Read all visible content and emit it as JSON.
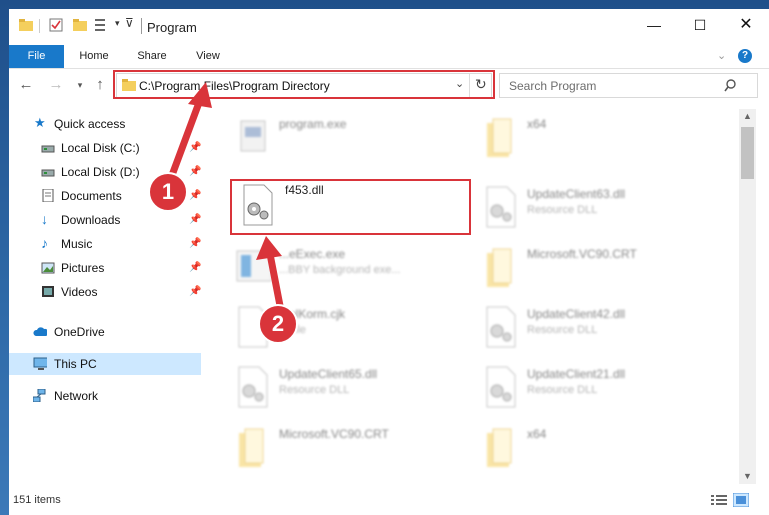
{
  "window": {
    "title": "Program"
  },
  "ribbon": {
    "tabs": [
      "File",
      "Home",
      "Share",
      "View"
    ]
  },
  "address": {
    "path": "C:\\Program Files\\Program Directory"
  },
  "search": {
    "placeholder": "Search Program"
  },
  "sidebar": {
    "items": [
      {
        "label": "Quick access",
        "icon": "star-icon"
      },
      {
        "label": "Local Disk (C:)",
        "icon": "drive-icon",
        "pinned": true
      },
      {
        "label": "Local Disk (D:)",
        "icon": "drive-icon",
        "pinned": true
      },
      {
        "label": "Documents",
        "icon": "documents-icon",
        "pinned": true
      },
      {
        "label": "Downloads",
        "icon": "download-icon",
        "pinned": true
      },
      {
        "label": "Music",
        "icon": "music-icon",
        "pinned": true
      },
      {
        "label": "Pictures",
        "icon": "pictures-icon",
        "pinned": true
      },
      {
        "label": "Videos",
        "icon": "videos-icon",
        "pinned": true
      },
      {
        "label": "OneDrive",
        "icon": "cloud-icon"
      },
      {
        "label": "This PC",
        "icon": "computer-icon",
        "selected": true
      },
      {
        "label": "Network",
        "icon": "network-icon"
      }
    ]
  },
  "files": [
    {
      "name": "program.exe",
      "sub": "",
      "kind": "exe"
    },
    {
      "name": "x64",
      "sub": "",
      "kind": "folder"
    },
    {
      "name": "f453.dll",
      "sub": "",
      "kind": "dll",
      "highlight": true
    },
    {
      "name": "UpdateClient63.dll",
      "sub": "Resource DLL",
      "kind": "dll"
    },
    {
      "name": "...eExec.exe",
      "sub": "...BBY background exe...",
      "kind": "exe"
    },
    {
      "name": "Microsoft.VC90.CRT",
      "sub": "",
      "kind": "folder"
    },
    {
      "name": "...elKorm.cjk",
      "sub": "...File",
      "kind": "file"
    },
    {
      "name": "UpdateClient42.dll",
      "sub": "Resource DLL",
      "kind": "dll"
    },
    {
      "name": "UpdateClient65.dll",
      "sub": "Resource DLL",
      "kind": "dll"
    },
    {
      "name": "UpdateClient21.dll",
      "sub": "Resource DLL",
      "kind": "dll"
    },
    {
      "name": "Microsoft.VC90.CRT",
      "sub": "",
      "kind": "folder"
    },
    {
      "name": "x64",
      "sub": "",
      "kind": "folder"
    }
  ],
  "status": {
    "count": "151 items"
  },
  "callouts": [
    "1",
    "2"
  ],
  "colors": {
    "accent": "#1979ca",
    "highlight": "#d9343a",
    "selection": "#cde8ff"
  }
}
